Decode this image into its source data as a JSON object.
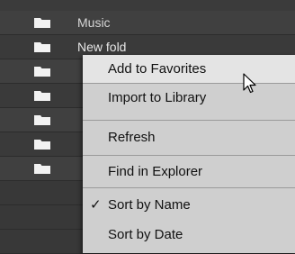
{
  "browser": {
    "rows": [
      {
        "label": "Music"
      },
      {
        "label": "New fold"
      }
    ]
  },
  "context_menu": {
    "items": [
      {
        "label": "Add to Favorites",
        "hovered": true
      },
      {
        "label": "Import to Library"
      },
      {
        "label": "Refresh"
      },
      {
        "label": "Find in Explorer"
      },
      {
        "label": "Sort by Name",
        "checked": true,
        "check_glyph": "✓"
      },
      {
        "label": "Sort by Date"
      }
    ]
  },
  "icons": {
    "folder": "folder-icon",
    "cursor": "mouse-pointer-icon",
    "check": "checkmark-icon"
  },
  "colors": {
    "background": "#3b3b3b",
    "menu_bg": "#cfcfcf",
    "menu_hover": "#e4e4e4",
    "folder_icon": "#f2f2f2"
  }
}
